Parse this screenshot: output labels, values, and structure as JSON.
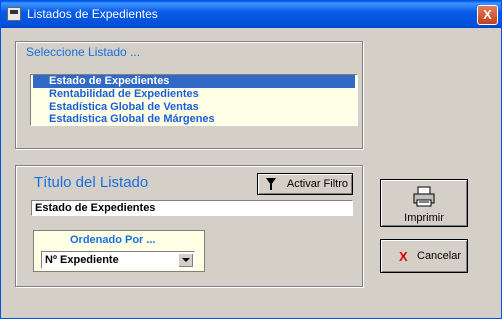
{
  "window": {
    "title": "Listados de Expedientes",
    "close_glyph": "X"
  },
  "listado_group": {
    "label": "Seleccione Listado ...",
    "items": [
      {
        "label": "Estado de Expedientes",
        "selected": true
      },
      {
        "label": "Rentabilidad de Expedientes",
        "selected": false
      },
      {
        "label": "Estadística Global de Ventas",
        "selected": false
      },
      {
        "label": "Estadística Global de Márgenes",
        "selected": false
      }
    ]
  },
  "titulo_group": {
    "label": "Título del Listado",
    "filter_button": "Activar Filtro",
    "title_value": "Estado de Expedientes",
    "order_label": "Ordenado Por ...",
    "order_value": "Nº Expediente"
  },
  "actions": {
    "print_label": "Imprimir",
    "cancel_label": "Cancelar",
    "cancel_glyph": "X"
  },
  "colors": {
    "accent": "#1a6fe0",
    "selection": "#3169c6",
    "list_bg": "#ffffe6",
    "titlebar": "#0a5ce8"
  }
}
